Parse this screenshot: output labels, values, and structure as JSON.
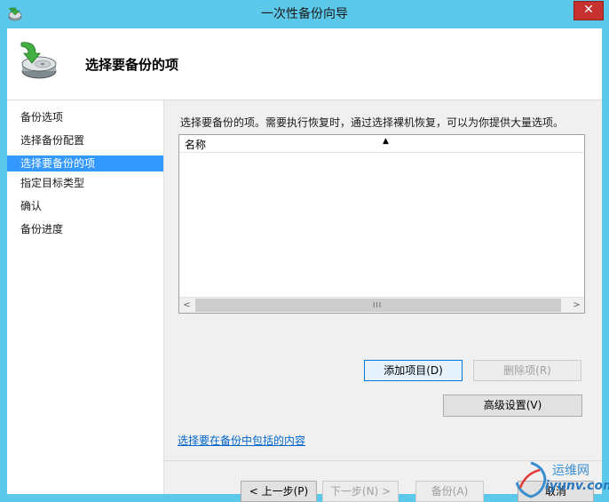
{
  "window": {
    "title": "一次性备份向导",
    "close_label": "✕"
  },
  "header": {
    "title": "选择要备份的项"
  },
  "sidebar": {
    "items": [
      {
        "label": "备份选项"
      },
      {
        "label": "选择备份配置"
      },
      {
        "label": "选择要备份的项",
        "active": true
      },
      {
        "label": "指定目标类型"
      },
      {
        "label": "确认"
      },
      {
        "label": "备份进度"
      }
    ]
  },
  "main": {
    "description": "选择要备份的项。需要执行恢复时，通过选择裸机恢复，可以为你提供大量选项。",
    "list": {
      "column_name": "名称",
      "sort_glyph": "▲",
      "scroll_left": "<",
      "scroll_right": ">",
      "scroll_grip": "III"
    },
    "buttons": {
      "add": "添加项目(D)",
      "remove": "删除项(R)",
      "advanced": "高级设置(V)"
    },
    "link": "选择要在备份中包括的内容"
  },
  "footer": {
    "prev": "< 上一步(P)",
    "next": "下一步(N) >",
    "backup": "备份(A)",
    "cancel": "取消"
  },
  "watermark": {
    "line1": "运维网",
    "line2": "iyunv.com"
  },
  "icons": {
    "app": "backup-app-icon",
    "header": "backup-drive-icon"
  },
  "colors": {
    "titlebar": "#5cc8ea",
    "selected": "#3399ff",
    "close": "#c7312f",
    "link": "#0066cc"
  }
}
